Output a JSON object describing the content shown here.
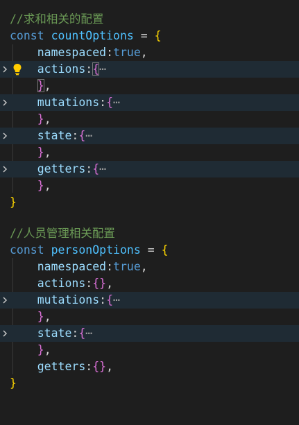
{
  "block1": {
    "comment": "//求和相关的配置",
    "kw": "const",
    "name": "countOptions",
    "eq": "=",
    "open": "{",
    "props": {
      "namespaced": "namespaced",
      "namespaced_value": "true",
      "actions": "actions",
      "mutations": "mutations",
      "state": "state",
      "getters": "getters"
    },
    "close": "}"
  },
  "block2": {
    "comment": "//人员管理相关配置",
    "kw": "const",
    "name": "personOptions",
    "eq": "=",
    "open": "{",
    "props": {
      "namespaced": "namespaced",
      "namespaced_value": "true",
      "actions": "actions",
      "mutations": "mutations",
      "state": "state",
      "getters": "getters"
    },
    "close": "}"
  },
  "punct": {
    "colon": ":",
    "comma": ",",
    "open_brace": "{",
    "close_brace": "}",
    "ellipsis": "⋯"
  },
  "colors": {
    "background": "#1e1e1e",
    "highlight": "#1f2b34",
    "comment": "#6a9955",
    "keyword": "#569cd6",
    "constant": "#4fc1ff",
    "property": "#9cdcfe",
    "bracket_outer": "#ffd700",
    "bracket_inner": "#da70d6",
    "lightbulb": "#ffcc00"
  },
  "icons": {
    "fold": "chevron-right-icon",
    "lightbulb": "lightbulb-icon"
  }
}
